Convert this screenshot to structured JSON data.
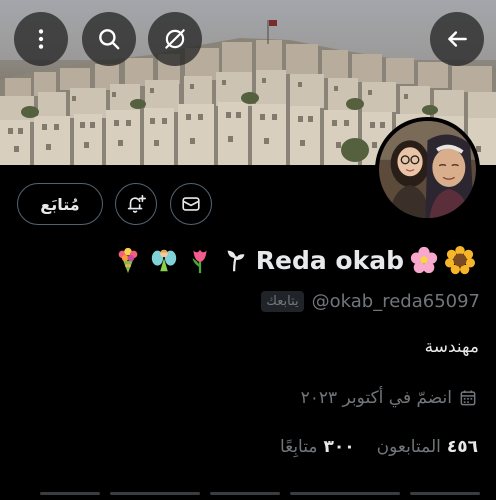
{
  "header": {
    "back_icon": "arrow-left-icon",
    "more_icon": "more-vertical-icon",
    "search_icon": "search-icon",
    "grok_icon": "grok-icon"
  },
  "actions": {
    "follow_label": "مُتابَع",
    "notify_icon": "bell-plus-icon",
    "message_icon": "mail-icon"
  },
  "profile": {
    "display_name": "Reda okab",
    "emojis": [
      "sunflower",
      "cherry-blossom",
      "seedling",
      "tulip",
      "fairy",
      "bouquet"
    ],
    "handle": "@okab_reda65097",
    "follows_you_label": "يتابعك",
    "bio": "مهندسة",
    "joined": "انضمّ في أكتوبر ٢٠٢٣",
    "calendar_icon": "calendar-icon",
    "stats": {
      "following_count": "٣٠٠",
      "following_label": "متابِعًا",
      "followers_count": "٤٥٦",
      "followers_label": "المتابعون"
    }
  },
  "colors": {
    "background": "#000000",
    "text_primary": "#e7e9ea",
    "text_secondary": "#71767b",
    "border": "#536471"
  }
}
